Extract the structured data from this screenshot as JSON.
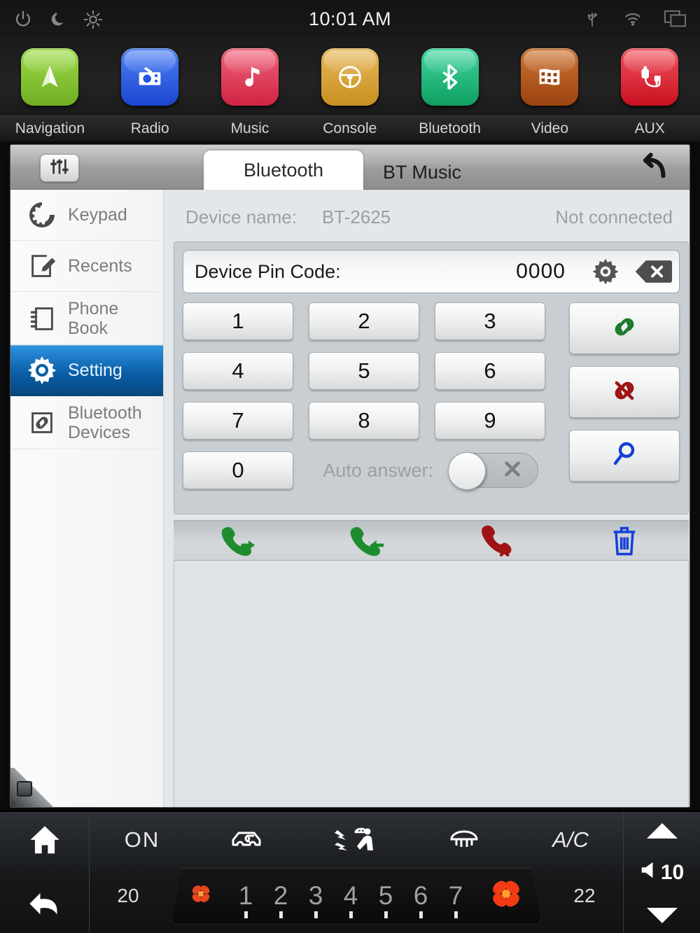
{
  "statusbar": {
    "clock": "10:01 AM",
    "left_icons": [
      "power-icon",
      "night-mode-icon",
      "brightness-icon"
    ],
    "right_icons": [
      "usb-icon",
      "wifi-icon",
      "multitask-icon"
    ]
  },
  "launcher": {
    "apps": [
      {
        "label": "Navigation",
        "icon": "navigation-arrow-icon",
        "color": "#79c32a"
      },
      {
        "label": "Radio",
        "icon": "radio-icon",
        "color": "#2258e8"
      },
      {
        "label": "Music",
        "icon": "music-note-icon",
        "color": "#e0374f"
      },
      {
        "label": "Console",
        "icon": "steering-wheel-icon",
        "color": "#d8a23a"
      },
      {
        "label": "Bluetooth",
        "icon": "bluetooth-icon",
        "color": "#15b574"
      },
      {
        "label": "Video",
        "icon": "film-strip-icon",
        "color": "#b6561a"
      },
      {
        "label": "AUX",
        "icon": "aux-cable-icon",
        "color": "#e2273a"
      }
    ]
  },
  "window": {
    "eq_icon": "equalizer-icon",
    "back_icon": "back-arrow-icon",
    "tabs": [
      {
        "label": "Bluetooth",
        "active": true
      },
      {
        "label": "BT Music",
        "active": false
      }
    ]
  },
  "sidebar": {
    "items": [
      {
        "label": "Keypad",
        "icon": "rotary-dial-icon",
        "active": false
      },
      {
        "label": "Recents",
        "icon": "note-pencil-icon",
        "active": false
      },
      {
        "label": "Phone Book",
        "icon": "notebook-icon",
        "active": false
      },
      {
        "label": "Setting",
        "icon": "gear-icon",
        "active": true
      },
      {
        "label": "Bluetooth Devices",
        "icon": "chain-link-icon",
        "active": false
      }
    ],
    "active_color": "#0a5fa8"
  },
  "device": {
    "name_label": "Device name:",
    "name_value": "BT-2625",
    "status": "Not connected"
  },
  "pin": {
    "label": "Device Pin Code:",
    "value": "0000",
    "settings_icon": "gear-icon",
    "backspace_icon": "backspace-icon"
  },
  "keypad": {
    "rows": [
      [
        "1",
        "2",
        "3"
      ],
      [
        "4",
        "5",
        "6"
      ],
      [
        "7",
        "8",
        "9"
      ]
    ],
    "zero": "0"
  },
  "auto_answer": {
    "label": "Auto answer:",
    "state": "off",
    "off_icon": "x-icon"
  },
  "action_buttons": [
    {
      "name": "connect-button",
      "icon": "chain-link-icon",
      "color": "#1d7a2f"
    },
    {
      "name": "disconnect-button",
      "icon": "broken-chain-icon",
      "color": "#9e1414"
    },
    {
      "name": "search-button",
      "icon": "magnifier-icon",
      "color": "#1340d8"
    }
  ],
  "call_tools": [
    {
      "name": "outgoing-call-button",
      "icon": "phone-outgoing-icon",
      "color": "#1e8c2e"
    },
    {
      "name": "incoming-call-button",
      "icon": "phone-incoming-icon",
      "color": "#1e8c2e"
    },
    {
      "name": "missed-call-button",
      "icon": "phone-missed-icon",
      "color": "#9e1414"
    },
    {
      "name": "delete-button",
      "icon": "trash-icon",
      "color": "#1340d8"
    }
  ],
  "climate": {
    "home_icon": "home-icon",
    "back_icon": "back-arrow-icon",
    "power_state": "ON",
    "ac_label": "A/C",
    "icons": [
      "recirculation-icon",
      "airflow-seat-icon",
      "defrost-icon"
    ],
    "temp_left": "20",
    "temp_right": "22",
    "fan_levels": [
      "1",
      "2",
      "3",
      "4",
      "5",
      "6",
      "7"
    ],
    "fan_icon_small": "fan-icon",
    "fan_icon_large": "fan-icon",
    "volume": "10",
    "volume_icon": "speaker-icon",
    "volume_up_icon": "triangle-up-icon",
    "volume_down_icon": "triangle-down-icon"
  }
}
